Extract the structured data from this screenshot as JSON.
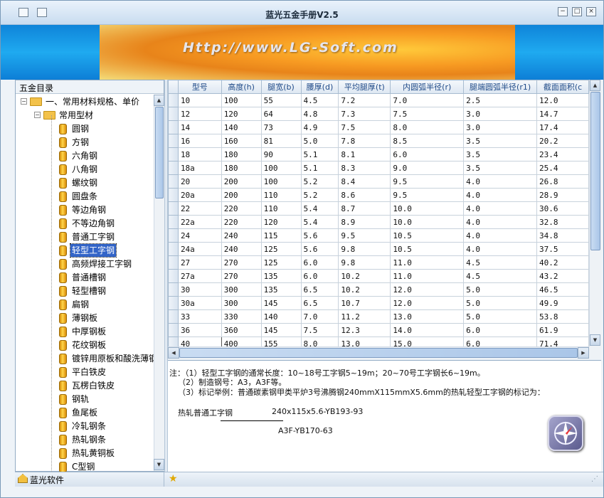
{
  "window": {
    "title": "蓝光五金手册V2.5",
    "minimize": "−",
    "restore": "□",
    "close": "×"
  },
  "banner": {
    "url": "Http://www.LG-Soft.com"
  },
  "sidebar": {
    "title": "五金目录",
    "root": "一、常用材料规格、单价",
    "group": "常用型材",
    "items": [
      "圆钢",
      "方钢",
      "六角钢",
      "八角钢",
      "螺纹钢",
      "圆盘条",
      "等边角钢",
      "不等边角钢",
      "普通工字钢",
      "轻型工字钢",
      "高频焊接工字钢",
      "普通槽钢",
      "轻型槽钢",
      "扁钢",
      "薄钢板",
      "中厚钢板",
      "花纹钢板",
      "镀锌用原板和酸洗薄钢",
      "平白铁皮",
      "瓦楞白铁皮",
      "钢轨",
      "鱼尾板",
      "冷轧钢条",
      "热轧钢条",
      "热轧黄铜板",
      "C型钢"
    ],
    "selected_index": 9
  },
  "table": {
    "headers": [
      "型号",
      "高度(h)",
      "腿宽(b)",
      "腰厚(d)",
      "平均腿厚(t)",
      "内圆弧半径(r)",
      "腿端圆弧半径(r1)",
      "截面面积(c"
    ],
    "rows": [
      [
        "10",
        "100",
        "55",
        "4.5",
        "7.2",
        "7.0",
        "2.5",
        "12.0"
      ],
      [
        "12",
        "120",
        "64",
        "4.8",
        "7.3",
        "7.5",
        "3.0",
        "14.7"
      ],
      [
        "14",
        "140",
        "73",
        "4.9",
        "7.5",
        "8.0",
        "3.0",
        "17.4"
      ],
      [
        "16",
        "160",
        "81",
        "5.0",
        "7.8",
        "8.5",
        "3.5",
        "20.2"
      ],
      [
        "18",
        "180",
        "90",
        "5.1",
        "8.1",
        "6.0",
        "3.5",
        "23.4"
      ],
      [
        "18a",
        "180",
        "100",
        "5.1",
        "8.3",
        "9.0",
        "3.5",
        "25.4"
      ],
      [
        "20",
        "200",
        "100",
        "5.2",
        "8.4",
        "9.5",
        "4.0",
        "26.8"
      ],
      [
        "20a",
        "200",
        "110",
        "5.2",
        "8.6",
        "9.5",
        "4.0",
        "28.9"
      ],
      [
        "22",
        "220",
        "110",
        "5.4",
        "8.7",
        "10.0",
        "4.0",
        "30.6"
      ],
      [
        "22a",
        "220",
        "120",
        "5.4",
        "8.9",
        "10.0",
        "4.0",
        "32.8"
      ],
      [
        "24",
        "240",
        "115",
        "5.6",
        "9.5",
        "10.5",
        "4.0",
        "34.8"
      ],
      [
        "24a",
        "240",
        "125",
        "5.6",
        "9.8",
        "10.5",
        "4.0",
        "37.5"
      ],
      [
        "27",
        "270",
        "125",
        "6.0",
        "9.8",
        "11.0",
        "4.5",
        "40.2"
      ],
      [
        "27a",
        "270",
        "135",
        "6.0",
        "10.2",
        "11.0",
        "4.5",
        "43.2"
      ],
      [
        "30",
        "300",
        "135",
        "6.5",
        "10.2",
        "12.0",
        "5.0",
        "46.5"
      ],
      [
        "30a",
        "300",
        "145",
        "6.5",
        "10.7",
        "12.0",
        "5.0",
        "49.9"
      ],
      [
        "33",
        "330",
        "140",
        "7.0",
        "11.2",
        "13.0",
        "5.0",
        "53.8"
      ],
      [
        "36",
        "360",
        "145",
        "7.5",
        "12.3",
        "14.0",
        "6.0",
        "61.9"
      ],
      [
        "40",
        "400",
        "155",
        "8.0",
        "13.0",
        "15.0",
        "6.0",
        "71.4"
      ]
    ]
  },
  "note": {
    "line1": "注：（1）轻型工字钢的通常长度：10~18号工字钢5~19m；20~70号工字钢长6~19m。",
    "line2": "（2）制造钢号：A3，A3F等。",
    "line3": "（3）标记举例：普通碳素钢甲类平炉3号沸腾钢240mmX115mmX5.6mm的热轧轻型工字钢的标记为：",
    "label": "热轧普通工字钢",
    "numerator": "240x115x5.6-YB193-93",
    "denominator": "A3F-YB170-63"
  },
  "status": {
    "left": "蓝光软件"
  }
}
